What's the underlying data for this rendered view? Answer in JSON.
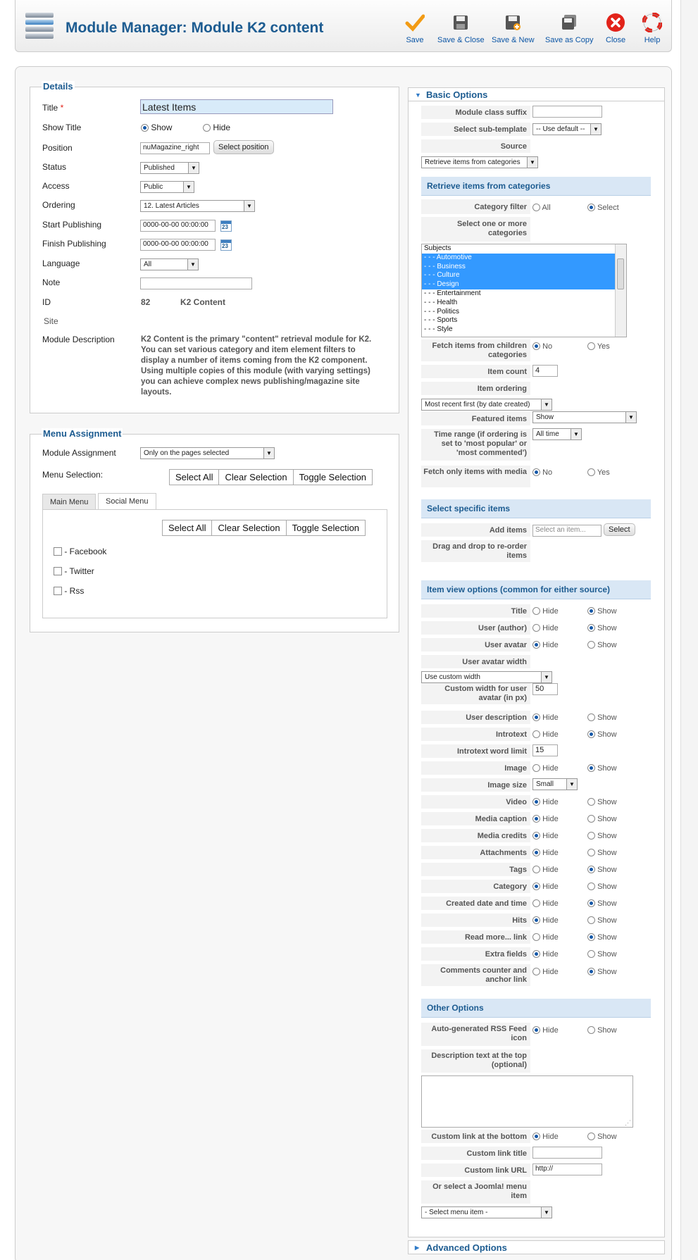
{
  "toolbar": {
    "title": "Module Manager: Module K2 content",
    "buttons": [
      {
        "label": "Save",
        "icon": "checkmark-icon"
      },
      {
        "label": "Save & Close",
        "icon": "floppy-icon"
      },
      {
        "label": "Save & New",
        "icon": "floppy-plus-icon"
      },
      {
        "label": "Save as Copy",
        "icon": "floppy-copy-icon"
      },
      {
        "label": "Close",
        "icon": "close-icon"
      },
      {
        "label": "Help",
        "icon": "lifebuoy-icon"
      }
    ],
    "colors": {
      "accent": "#1d5c91",
      "save": "#f29b14",
      "close": "#e2231a"
    }
  },
  "details": {
    "legend": "Details",
    "title_label": "Title",
    "required_mark": "*",
    "title_value": "Latest Items",
    "show_title_label": "Show Title",
    "show_opt": "Show",
    "hide_opt": "Hide",
    "position_label": "Position",
    "position_value": "nuMagazine_right",
    "select_position": "Select position",
    "status_label": "Status",
    "status_value": "Published",
    "access_label": "Access",
    "access_value": "Public",
    "ordering_label": "Ordering",
    "ordering_value": "12. Latest Articles",
    "start_label": "Start Publishing",
    "start_value": "0000-00-00 00:00:00",
    "finish_label": "Finish Publishing",
    "finish_value": "0000-00-00 00:00:00",
    "calendar_day": "23",
    "language_label": "Language",
    "language_value": "All",
    "note_label": "Note",
    "note_value": "",
    "id_label": "ID",
    "id_value": "82",
    "module_type": "K2 Content",
    "site_label": "Site",
    "desc_label": "Module Description",
    "desc_lines": [
      "K2 Content is the primary \"content\" retrieval module for K2.",
      "You can set various category and item element filters to",
      "display a number of items coming from the K2 component.",
      "Using multiple copies of this module (with varying settings)",
      "you can achieve complex news publishing/magazine site",
      "layouts."
    ]
  },
  "menu": {
    "legend": "Menu Assignment",
    "assign_label": "Module Assignment",
    "assign_value": "Only on the pages selected",
    "selection_label": "Menu Selection:",
    "select_all": "Select All",
    "clear_selection": "Clear Selection",
    "toggle_selection": "Toggle Selection",
    "tabs": [
      "Main Menu",
      "Social Menu"
    ],
    "items": [
      "- Facebook",
      "- Twitter",
      "- Rss"
    ]
  },
  "basic": {
    "header": "Basic Options",
    "module_class_suffix": "Module class suffix",
    "select_sub_template": "Select sub-template",
    "sub_template_value": "-- Use default --",
    "source": "Source",
    "source_value": "Retrieve items from categories",
    "sec_categories": "Retrieve items from categories",
    "category_filter": "Category filter",
    "all": "All",
    "select": "Select",
    "select_categories": "Select one or more categories",
    "categories": [
      "Subjects",
      "- - - Automotive",
      "- - - Business",
      "- - - Culture",
      "- - - Design",
      "- - - Entertainment",
      "- - - Health",
      "- - - Politics",
      "- - - Sports",
      "- - - Style"
    ],
    "fetch_children": "Fetch items from children categories",
    "no": "No",
    "yes": "Yes",
    "item_count": "Item count",
    "item_count_value": "4",
    "item_ordering": "Item ordering",
    "item_ordering_value": "Most recent first (by date created)",
    "featured_items": "Featured items",
    "featured_value": "Show",
    "time_range": "Time range (if ordering is set to 'most popular' or 'most commented')",
    "time_range_value": "All time",
    "fetch_media": "Fetch only items with media",
    "sec_specific": "Select specific items",
    "add_items": "Add items",
    "add_items_placeholder": "Select an item...",
    "select_btn": "Select",
    "drag_drop": "Drag and drop to re-order items",
    "sec_view": "Item view options (common for either source)",
    "hide": "Hide",
    "show": "Show",
    "view_rows": [
      {
        "label": "Title",
        "on": "show"
      },
      {
        "label": "User (author)",
        "on": "show"
      },
      {
        "label": "User avatar",
        "on": "hide"
      },
      {
        "label": "User avatar width",
        "on": ""
      },
      {
        "label": "Custom width for user avatar (in px)",
        "on": ""
      },
      {
        "label": "User description",
        "on": "hide"
      },
      {
        "label": "Introtext",
        "on": "show"
      },
      {
        "label": "Introtext word limit",
        "on": ""
      },
      {
        "label": "Image",
        "on": "show"
      },
      {
        "label": "Image size",
        "on": ""
      },
      {
        "label": "Video",
        "on": "hide"
      },
      {
        "label": "Media caption",
        "on": "hide"
      },
      {
        "label": "Media credits",
        "on": "hide"
      },
      {
        "label": "Attachments",
        "on": "hide"
      },
      {
        "label": "Tags",
        "on": "show"
      },
      {
        "label": "Category",
        "on": "hide"
      },
      {
        "label": "Created date and time",
        "on": "show"
      },
      {
        "label": "Hits",
        "on": "hide"
      },
      {
        "label": "Read more... link",
        "on": "show"
      },
      {
        "label": "Extra fields",
        "on": "hide"
      },
      {
        "label": "Comments counter and anchor link",
        "on": "show"
      }
    ],
    "avatar_width_value": "Use custom width",
    "custom_width_value": "50",
    "word_limit_value": "15",
    "image_size_value": "Small",
    "sec_other": "Other Options",
    "rss_feed": "Auto-generated RSS Feed icon",
    "desc_top": "Description text at the top (optional)",
    "custom_link": "Custom link at the bottom",
    "custom_link_title": "Custom link title",
    "custom_link_url": "Custom link URL",
    "custom_link_url_value": "http://",
    "joomla_menu": "Or select a Joomla! menu item",
    "joomla_menu_value": "- Select menu item -"
  },
  "advanced": {
    "header": "Advanced Options"
  }
}
